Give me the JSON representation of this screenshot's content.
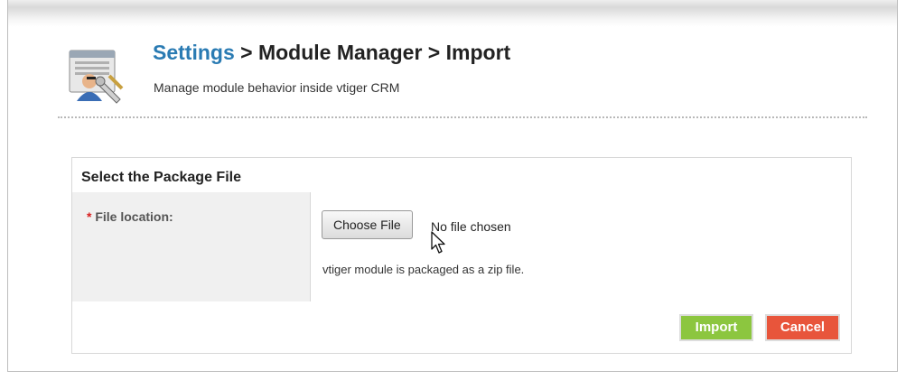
{
  "header": {
    "breadcrumb": {
      "root": "Settings",
      "sep1": " > ",
      "middle": "Module Manager",
      "sep2": " > ",
      "current": "Import"
    },
    "subtitle": "Manage module behavior inside vtiger CRM",
    "icon": "settings-tools-icon"
  },
  "panel": {
    "title": "Select the Package File",
    "field": {
      "required_marker": "*",
      "label": " File location:",
      "choose_button": "Choose File",
      "no_file_text": "No file chosen",
      "hint": "vtiger module is packaged as a zip file."
    }
  },
  "actions": {
    "import": "Import",
    "cancel": "Cancel"
  },
  "colors": {
    "link": "#2a7bb3",
    "import_button": "#8cc63f",
    "cancel_button": "#e8553b",
    "required": "#d81e1e"
  },
  "cursor": {
    "icon": "mouse-pointer-icon"
  }
}
